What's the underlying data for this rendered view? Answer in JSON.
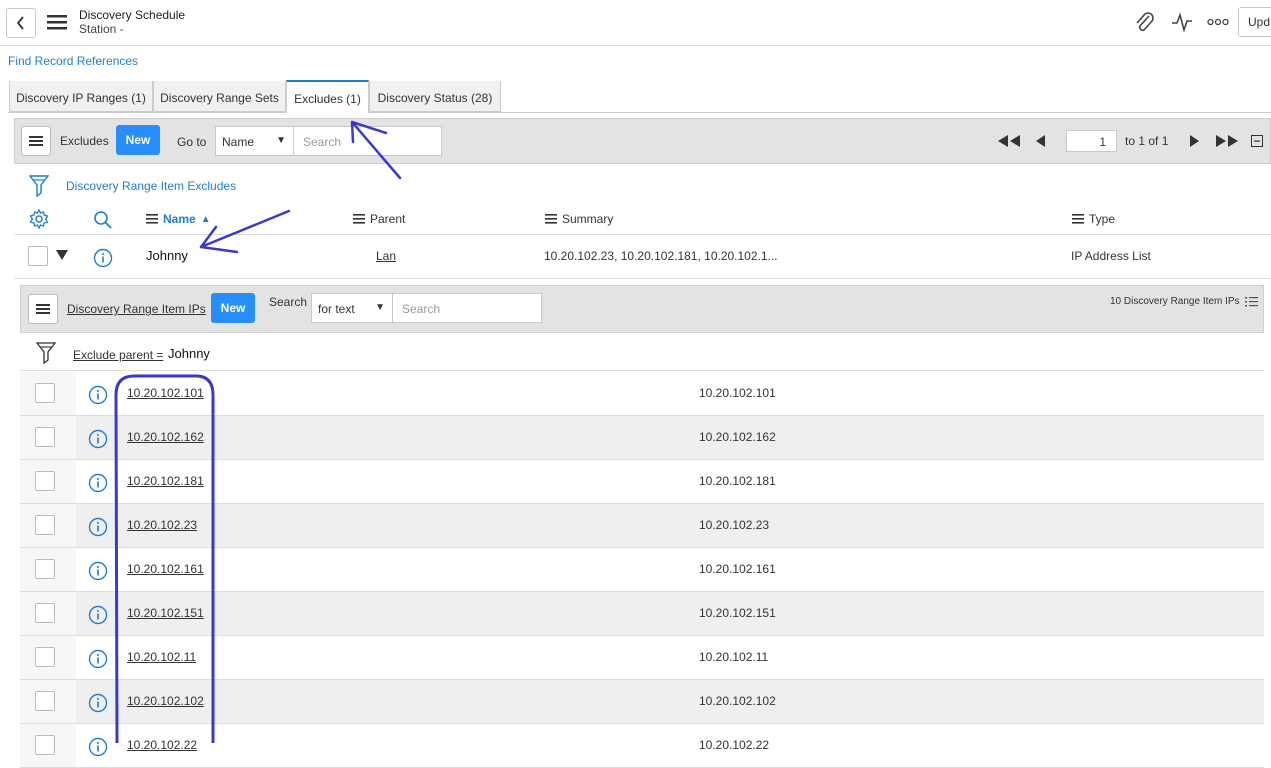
{
  "header": {
    "title": "Discovery Schedule",
    "subtitle": "Station -",
    "update_label": "Upd",
    "icons": [
      "back-icon",
      "hamburger-icon",
      "paperclip-icon",
      "activity-icon",
      "more-icon"
    ]
  },
  "find_record_references": "Find Record References",
  "tabs": [
    {
      "label": "Discovery IP Ranges (1)",
      "active": false
    },
    {
      "label": "Discovery Range Sets",
      "active": false
    },
    {
      "label": "Excludes (1)",
      "active": true
    },
    {
      "label": "Discovery Status (28)",
      "active": false
    }
  ],
  "excludes_list": {
    "title": "Excludes",
    "new_label": "New",
    "goto_label": "Go to",
    "goto_field": "Name",
    "search_placeholder": "Search",
    "pager": {
      "page": "1",
      "range_text": "to 1 of 1"
    },
    "filter_label": "Discovery Range Item Excludes",
    "columns": [
      "Name",
      "Parent",
      "Summary",
      "Type"
    ],
    "sort_indicator": "▲",
    "row": {
      "name": "Johnny",
      "parent": "Lan",
      "summary": "10.20.102.23, 10.20.102.181, 10.20.102.1...",
      "type": "IP Address List"
    }
  },
  "related_list": {
    "title": "Discovery Range Item IPs",
    "new_label": "New",
    "search_label": "Search",
    "search_field": "for text",
    "search_placeholder": "Search",
    "count_text": "10  Discovery Range Item IPs",
    "filter_text": "Exclude parent =",
    "filter_value": "Johnny",
    "rows": [
      {
        "ip": "10.20.102.101",
        "value": "10.20.102.101"
      },
      {
        "ip": "10.20.102.162",
        "value": "10.20.102.162"
      },
      {
        "ip": "10.20.102.181",
        "value": "10.20.102.181"
      },
      {
        "ip": "10.20.102.23",
        "value": "10.20.102.23"
      },
      {
        "ip": "10.20.102.161",
        "value": "10.20.102.161"
      },
      {
        "ip": "10.20.102.151",
        "value": "10.20.102.151"
      },
      {
        "ip": "10.20.102.11",
        "value": "10.20.102.11"
      },
      {
        "ip": "10.20.102.102",
        "value": "10.20.102.102"
      },
      {
        "ip": "10.20.102.22",
        "value": "10.20.102.22"
      }
    ]
  },
  "colors": {
    "accent": "#1f7ecf",
    "new_button": "#278efc",
    "annotation": "#3a3ac8"
  }
}
